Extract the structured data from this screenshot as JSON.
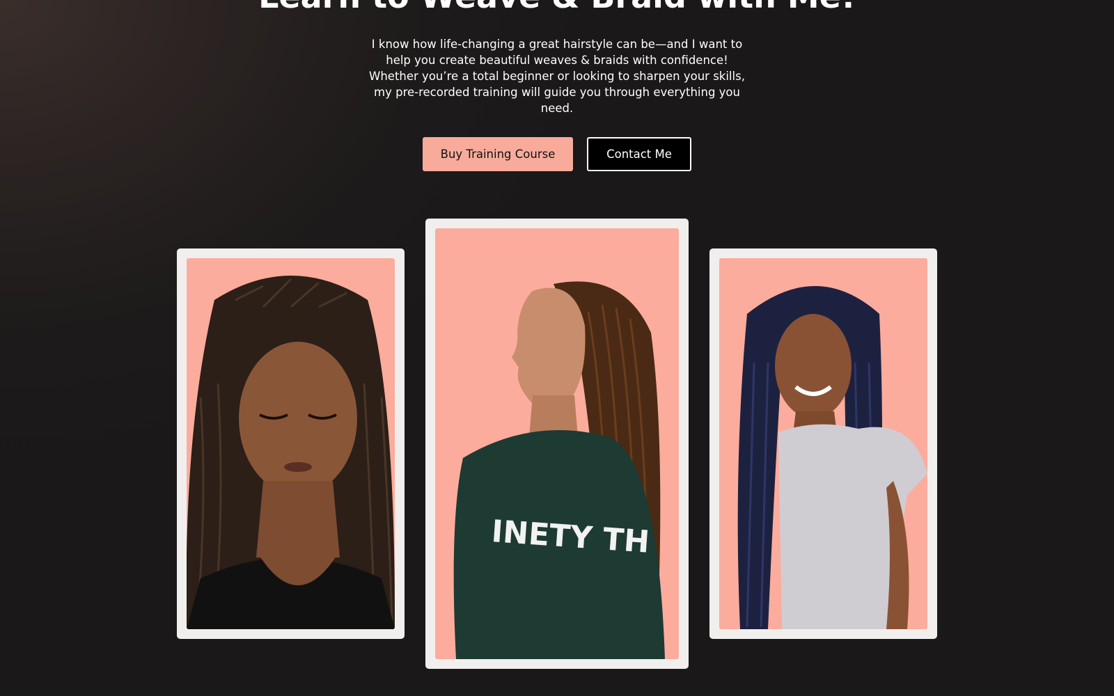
{
  "hero": {
    "title": "Learn to Weave & Braid with Me!",
    "description": "I know how life-changing a great hairstyle can be—and I want to help you create beautiful weaves & braids with confidence! Whether you’re a total beginner or looking to sharpen your skills, my pre-recorded training will guide you through everything you need."
  },
  "buttons": {
    "buy_label": "Buy Training Course",
    "contact_label": "Contact Me"
  },
  "gallery": {
    "center_shirt_text": "INETY TH"
  },
  "colors": {
    "accent": "#f8ab9b",
    "photo_bg": "#fbac9c",
    "card_frame": "#f1efee",
    "page_bg": "#1c1a1a"
  }
}
